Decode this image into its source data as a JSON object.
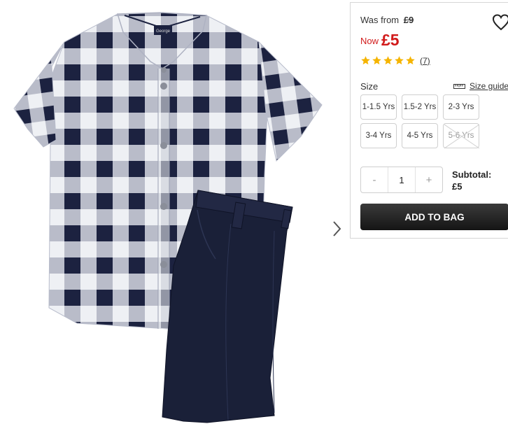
{
  "price": {
    "was_label": "Was from",
    "was_value": "£9",
    "now_label": "Now",
    "now_value": "£5",
    "accent_color": "#d11a1a"
  },
  "rating": {
    "stars": 5,
    "max_stars": 5,
    "count": "(7)",
    "star_color": "#f5b400"
  },
  "size": {
    "label": "Size",
    "guide_label": "Size guide",
    "options": [
      {
        "label": "1-1.5 Yrs",
        "available": true
      },
      {
        "label": "1.5-2 Yrs",
        "available": true
      },
      {
        "label": "2-3 Yrs",
        "available": true
      },
      {
        "label": "3-4 Yrs",
        "available": true
      },
      {
        "label": "4-5 Yrs",
        "available": true
      },
      {
        "label": "5-6 Yrs",
        "available": false
      }
    ]
  },
  "quantity": {
    "minus": "-",
    "value": "1",
    "plus": "+"
  },
  "subtotal": {
    "label": "Subtotal:",
    "value": "£5"
  },
  "add_to_bag_label": "ADD TO BAG",
  "icons": {
    "wishlist": "heart-outline-icon",
    "size_guide": "ruler-icon",
    "next_image": "chevron-right-icon"
  },
  "product_image": {
    "shirt_label_text": "George"
  }
}
